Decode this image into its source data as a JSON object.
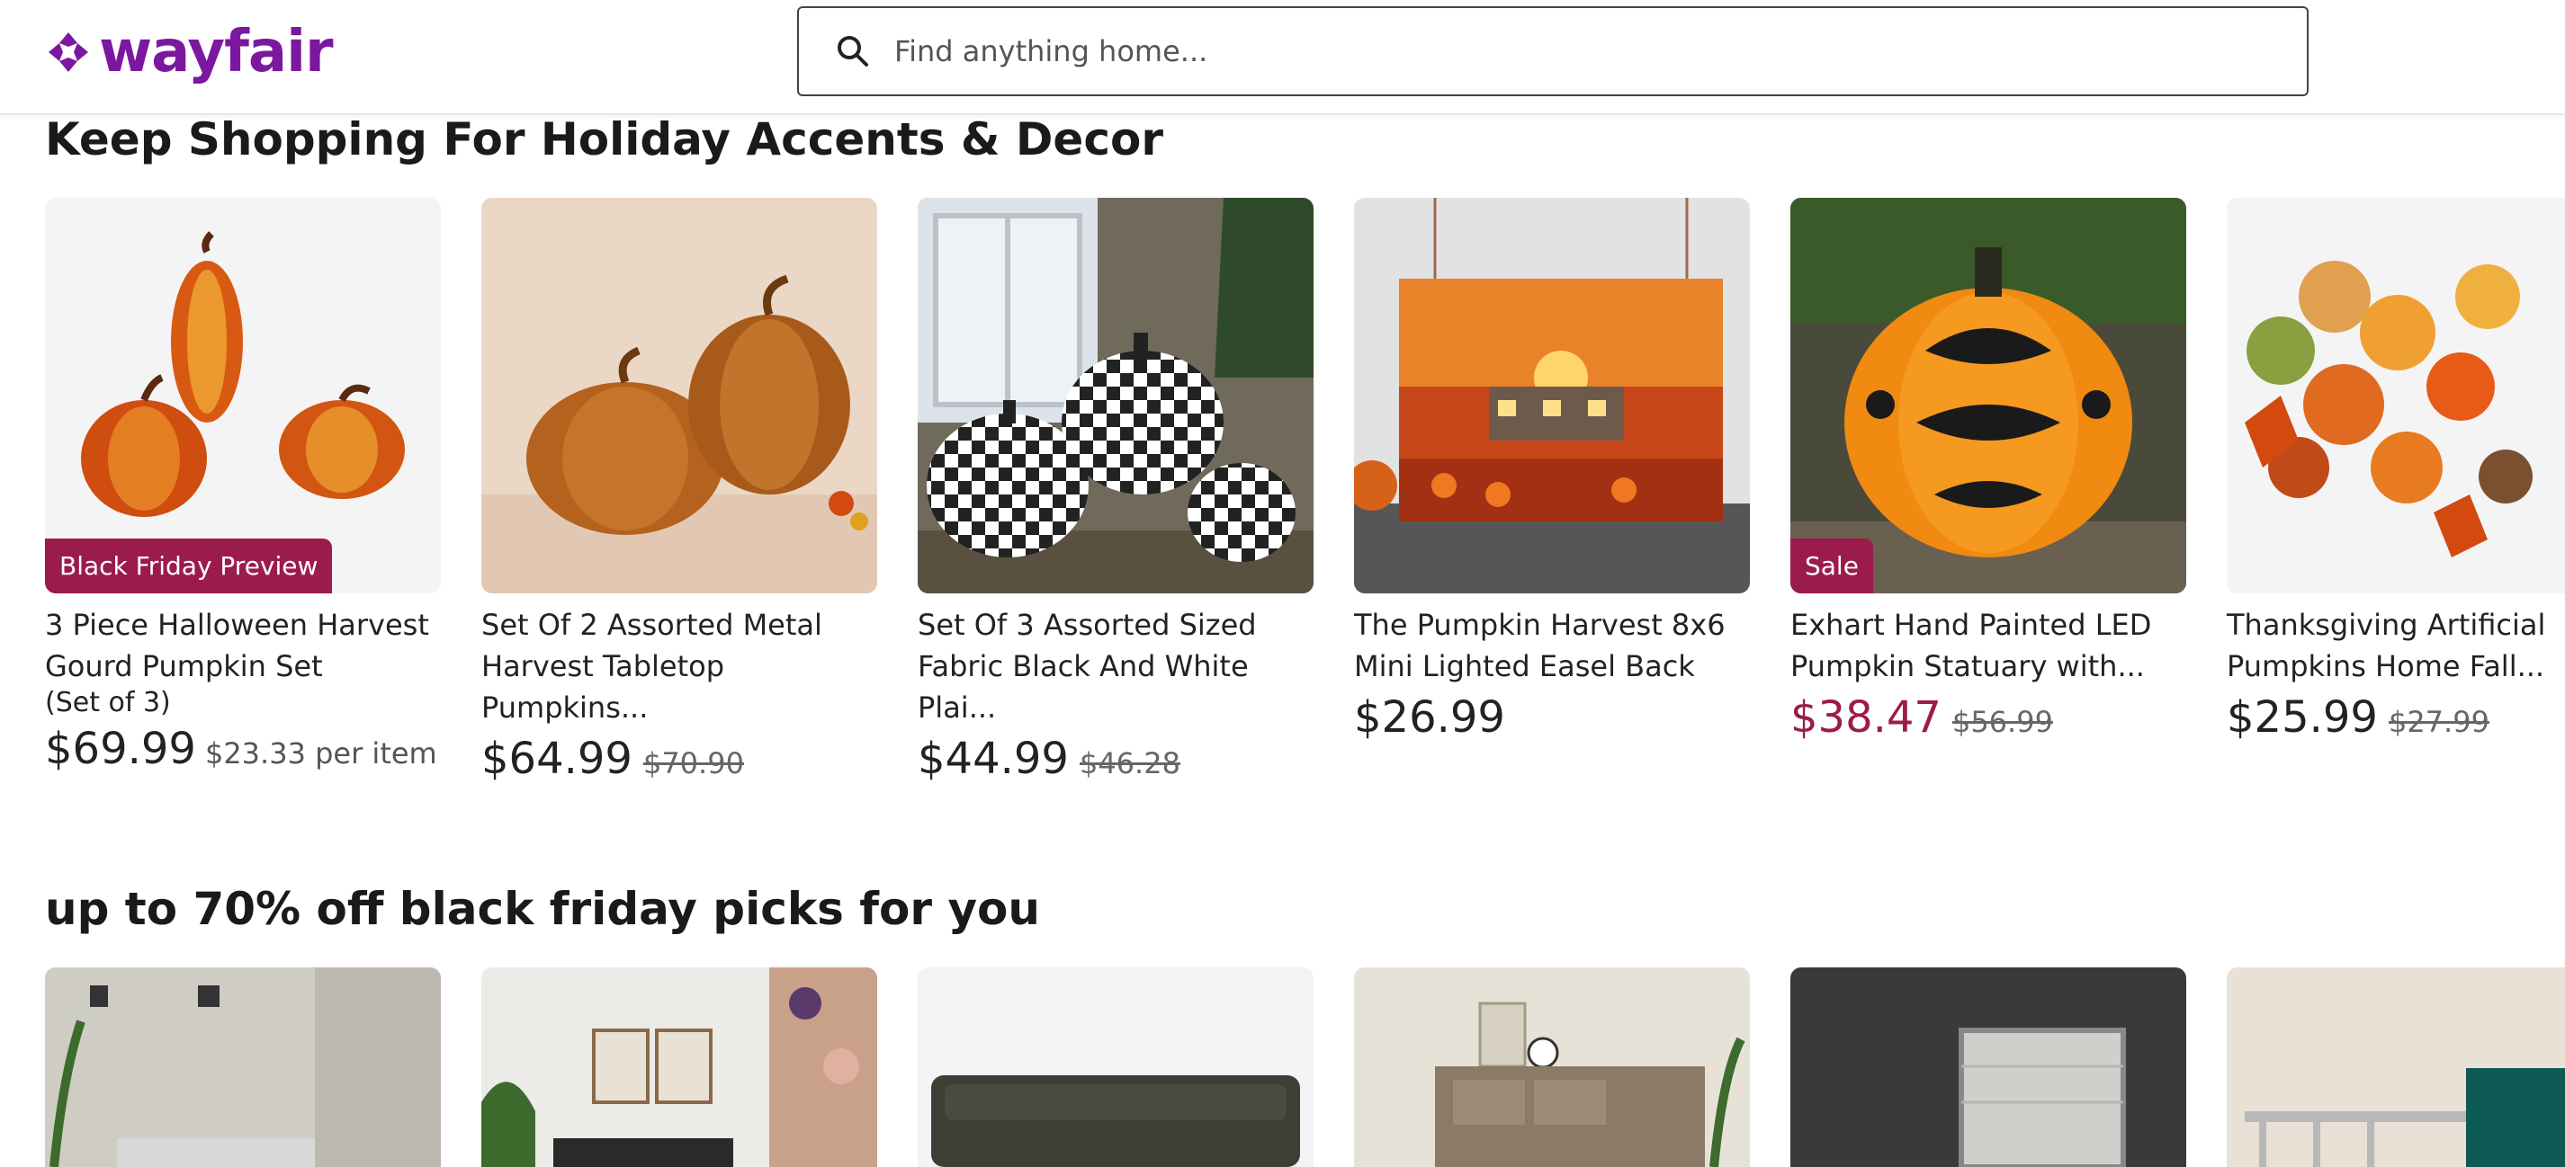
{
  "brand": {
    "name": "wayfair",
    "color": "#7b189f"
  },
  "search": {
    "placeholder": "Find anything home..."
  },
  "sections": [
    {
      "title": "Keep Shopping For Holiday Accents & Decor",
      "products": [
        {
          "name": "3 Piece Halloween Harvest Gourd Pumpkin Set",
          "subtitle": "(Set of 3)",
          "badge": "Black Friday Preview",
          "price": "$69.99",
          "was": "",
          "per_item": "$23.33 per item"
        },
        {
          "name": "Set Of 2 Assorted Metal Harvest Tabletop Pumpkins...",
          "price": "$64.99",
          "was": "$70.90"
        },
        {
          "name": "Set Of 3 Assorted Sized Fabric Black And White Plai...",
          "price": "$44.99",
          "was": "$46.28"
        },
        {
          "name": "The Pumpkin Harvest 8x6 Mini Lighted Easel Back",
          "price": "$26.99",
          "was": ""
        },
        {
          "name": "Exhart Hand Painted LED Pumpkin Statuary with...",
          "badge": "Sale",
          "price": "$38.47",
          "was": "$56.99"
        },
        {
          "name": "Thanksgiving Artificial Pumpkins Home Fall...",
          "price": "$25.99",
          "was": "$27.99"
        }
      ]
    },
    {
      "title": "up to 70% off black friday picks for you"
    }
  ],
  "colors": {
    "sale": "#9b1b4b",
    "frame": "#0e5b55"
  }
}
